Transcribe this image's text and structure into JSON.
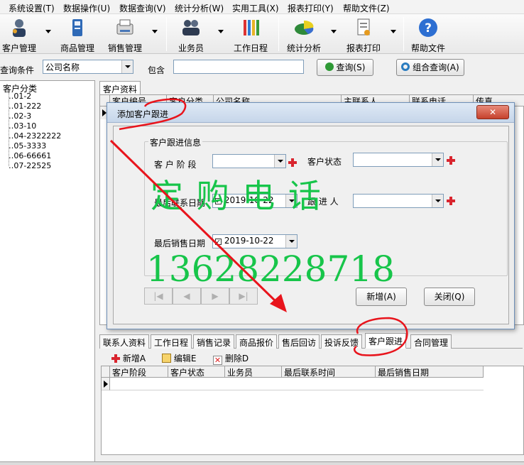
{
  "menu": [
    "系统设置(T)",
    "数据操作(U)",
    "数据查询(V)",
    "统计分析(W)",
    "实用工具(X)",
    "报表打印(Y)",
    "帮助文件(Z)"
  ],
  "toolbar": {
    "customer": "客户管理",
    "product": "商品管理",
    "sales": "销售管理",
    "salesman": "业务员",
    "schedule": "工作日程",
    "stats": "统计分析",
    "report": "报表打印",
    "help": "帮助文件"
  },
  "query": {
    "label": "查询条件",
    "field": "公司名称",
    "contains": "包含",
    "value": "",
    "search_btn": "查询(S)",
    "combo_btn": "组合查询(A)"
  },
  "tree": {
    "root": "客户分类",
    "items": [
      "01-2",
      "01-222",
      "02-3",
      "03-10",
      "04-2322222",
      "05-3333",
      "06-66661",
      "07-22525"
    ]
  },
  "top_tab": "客户资料",
  "top_grid_headers": [
    "客户编号",
    "客户分类",
    "公司名称",
    "主联系人",
    "联系电话",
    "传真"
  ],
  "dialog": {
    "title": "添加客户跟进",
    "group": "客户跟进信息",
    "stage_label": "客 户 阶 段",
    "stage_value": "",
    "status_label": "客户状态",
    "status_value": "",
    "last_contact_label": "最后联系日期",
    "last_contact_value": "2019-10-22",
    "follower_label": "跟 进 人",
    "follower_value": "",
    "last_sale_label": "最后销售日期",
    "last_sale_value": "2019-10-22",
    "add_btn": "新增(A)",
    "close_btn": "关闭(Q)",
    "nav": [
      "|◀",
      "◀",
      "▶",
      "▶|"
    ]
  },
  "watermark": {
    "line1": "定 购 电 话",
    "line2": "13628228718"
  },
  "bottom_tabs": [
    "联系人资料",
    "工作日程",
    "销售记录",
    "商品报价",
    "售后回访",
    "投诉反馈",
    "客户跟进",
    "合同管理"
  ],
  "actions": {
    "add": "新增A",
    "edit": "编辑E",
    "delete": "删除D"
  },
  "bottom_grid_headers": [
    "客户阶段",
    "客户状态",
    "业务员",
    "最后联系时间",
    "最后销售日期"
  ],
  "colors": {
    "annotation": "#e8141c",
    "watermark": "#17c54a",
    "title_bar": "#c6d6ea"
  }
}
